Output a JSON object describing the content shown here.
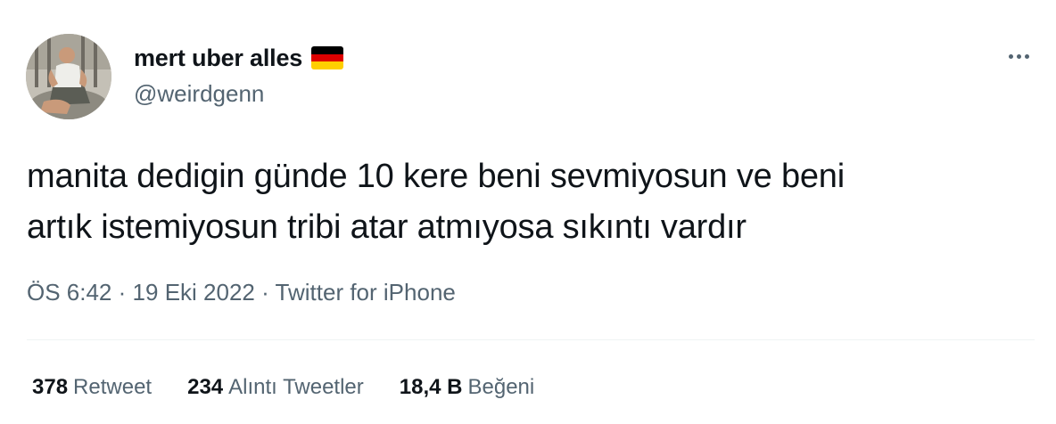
{
  "author": {
    "display_name": "mert uber alles",
    "handle": "@weirdgenn",
    "flag_icon": "germany-flag-icon"
  },
  "tweet": {
    "lines": [
      "manita dedigin günde 10 kere beni sevmiyosun ve beni",
      "artık istemiyosun tribi atar atmıyosa sıkıntı vardır"
    ]
  },
  "meta": {
    "time": "ÖS 6:42",
    "separator": "·",
    "date": "19 Eki 2022",
    "source": "Twitter for iPhone"
  },
  "stats": [
    {
      "count": "378",
      "label": "Retweet"
    },
    {
      "count": "234",
      "label": "Alıntı Tweetler"
    },
    {
      "count": "18,4 B",
      "label": "Beğeni"
    }
  ],
  "colors": {
    "text_primary": "#0f1419",
    "text_secondary": "#536471",
    "divider": "#eff3f4",
    "flag_black": "#000000",
    "flag_red": "#dd0000",
    "flag_gold": "#ffce00"
  }
}
